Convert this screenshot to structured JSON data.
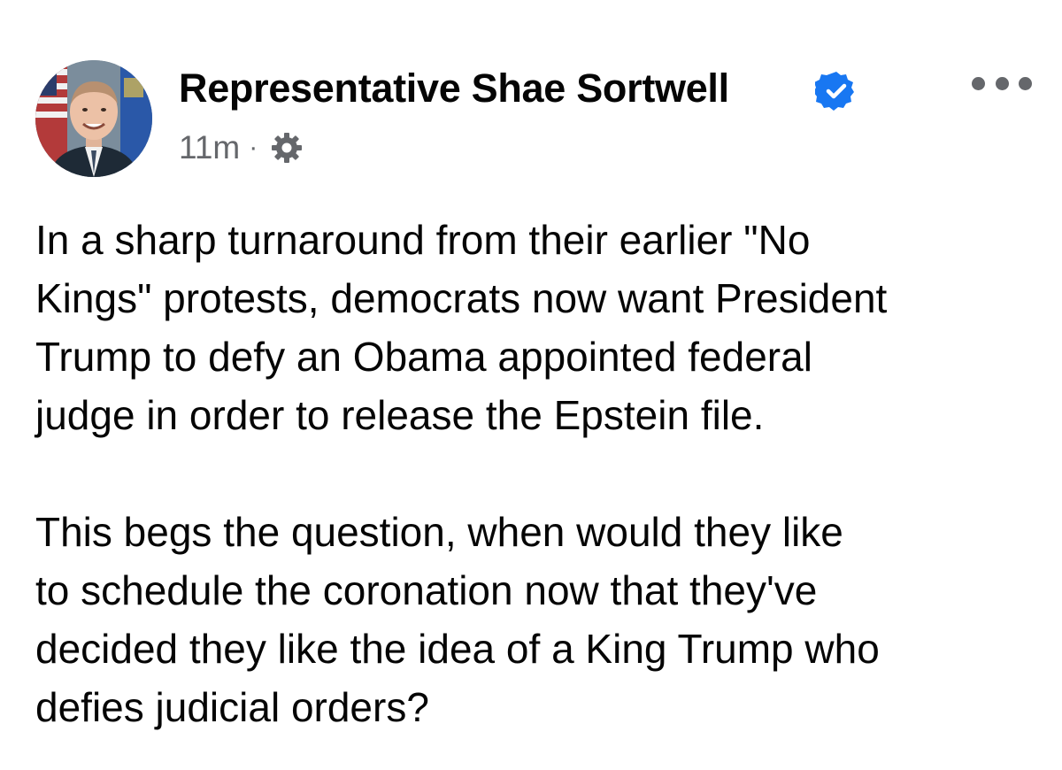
{
  "post": {
    "author": "Representative Shae Sortwell",
    "verified_icon": "verified-badge-icon",
    "verified_color": "#1877f2",
    "time": "11m",
    "separator": "·",
    "audience_icon": "gear-icon",
    "more_icon": "more-options-icon",
    "paragraph1_lines": [
      "In a sharp turnaround from their earlier \"No",
      "Kings\" protests, democrats now want President",
      "Trump to defy an Obama appointed federal",
      "judge in order to release the Epstein file."
    ],
    "paragraph2_lines": [
      "This begs the question,  when would they like",
      "to schedule the coronation now that they've",
      "decided they like the idea of a King Trump who",
      "defies judicial orders?"
    ]
  }
}
